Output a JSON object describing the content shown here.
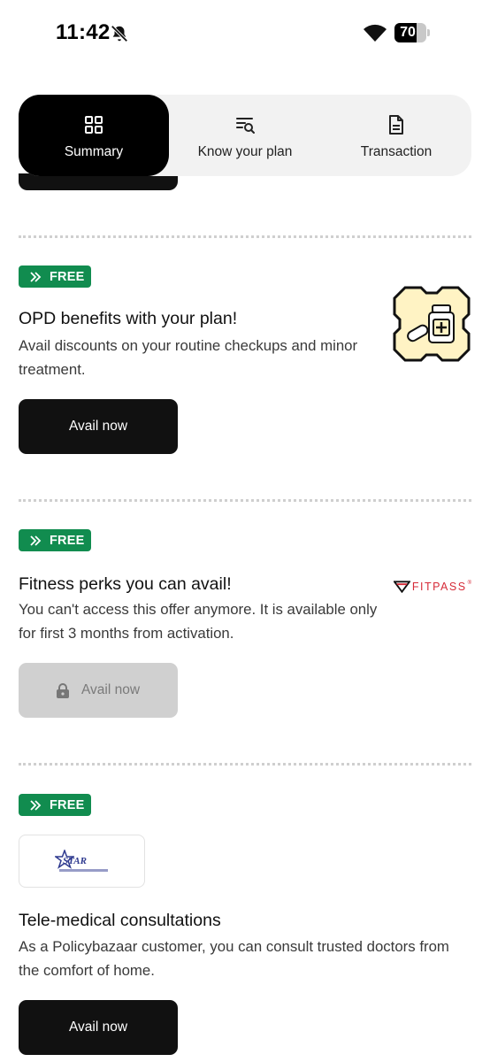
{
  "status_bar": {
    "time": "11:42",
    "battery_percent": "70",
    "battery_level": 0.7,
    "icons": [
      "bell-off-icon",
      "wifi-icon",
      "battery-icon"
    ]
  },
  "tabs": [
    {
      "label": "Summary",
      "icon": "grid-icon",
      "active": true
    },
    {
      "label": "Know your plan",
      "icon": "list-search-icon",
      "active": false
    },
    {
      "label": "Transaction",
      "icon": "document-icon",
      "active": false
    }
  ],
  "cards": [
    {
      "badge": "FREE",
      "title": "OPD benefits with your plan!",
      "description": "Avail discounts on your routine checkups and minor treatment.",
      "button_label": "Avail now",
      "button_enabled": true,
      "image": "medicine-bottle-illustration"
    },
    {
      "badge": "FREE",
      "title": "Fitness perks you can avail!",
      "description": "You can't access this offer anymore. It is available only for first 3 months from activation.",
      "button_label": "Avail now",
      "button_enabled": false,
      "logo_text": "FITPASS",
      "logo_mark": "®"
    },
    {
      "badge": "FREE",
      "logo_text": "STAR",
      "title": "Tele-medical consultations",
      "description": "As a Policybazaar customer, you can consult trusted doctors from the comfort of home.",
      "button_label": "Avail now",
      "button_enabled": true
    }
  ],
  "colors": {
    "badge_green": "#118c4f",
    "button_dark": "#111111",
    "button_disabled": "#d0d0d0",
    "tab_bg": "#f2f2f2",
    "fitpass_red": "#d62b38"
  }
}
